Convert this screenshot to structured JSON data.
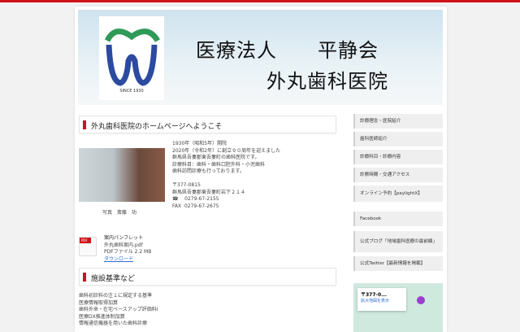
{
  "header": {
    "title_line1": "医療法人　　平静会",
    "title_line2": "外丸歯科医院",
    "logo_since": "SINCE 1930"
  },
  "welcome": {
    "heading": "外丸歯科医院のホームページへようこそ",
    "lines": [
      "1930年（昭和5年）開院",
      "2020年（令和2年）に創立９０周年を迎えました",
      "群馬県吾妻郡東吾妻町の歯科医院です。",
      "診療科目：歯科・歯科口腔外科・小児歯科",
      "歯科訪問診療も行っております。"
    ],
    "postal": "〒377-0815",
    "address": "群馬県吾妻郡東吾妻町岩下２１４",
    "tel_label": "☎",
    "tel": "0279-67-2155",
    "fax_label": "FAX",
    "fax": "0279-67-2675",
    "photo_caption": "写真　斎藤　功"
  },
  "pamphlet": {
    "title": "案内パンフレット",
    "file": "外丸歯科案内.pdf",
    "info": "PDFファイル 2.2 MB",
    "download": "ダウンロード",
    "icon_label": "PDF"
  },
  "standards": {
    "heading": "施設基準など",
    "items": [
      "歯科初診料の注１に規定する基準",
      "医療情報取得加算",
      "歯科外来・在宅ベースアップ評価料Ⅰ",
      "医療DX推進体制加算",
      "情報通信機器を用いた歯科診療"
    ]
  },
  "sidebar": {
    "items": [
      "診療理念・医院紹介",
      "歯科医師紹介",
      "診療科目・診療内容",
      "診察時間・交通アクセス",
      "オンライン予約【paylightX】",
      "Facebook",
      "公式ブログ「地域歯科医療の最前線」",
      "公式Twitter【最新情報を掲載】"
    ]
  },
  "map": {
    "postal": "〒377-0...",
    "link": "拡大地図を表示"
  }
}
